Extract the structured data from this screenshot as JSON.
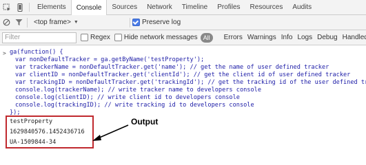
{
  "devtools": {
    "tabs": [
      {
        "label": "Elements",
        "active": false
      },
      {
        "label": "Console",
        "active": true
      },
      {
        "label": "Sources",
        "active": false
      },
      {
        "label": "Network",
        "active": false
      },
      {
        "label": "Timeline",
        "active": false
      },
      {
        "label": "Profiles",
        "active": false
      },
      {
        "label": "Resources",
        "active": false
      },
      {
        "label": "Audits",
        "active": false
      }
    ]
  },
  "toolbar": {
    "frame_select": "<top frame>",
    "preserve_log_label": "Preserve log",
    "preserve_log_checked": true
  },
  "filterbar": {
    "filter_placeholder": "Filter",
    "regex_label": "Regex",
    "hide_network_label": "Hide network messages",
    "all_label": "All",
    "levels": [
      "Errors",
      "Warnings",
      "Info",
      "Logs",
      "Debug",
      "Handled"
    ]
  },
  "console": {
    "input_lines": [
      "ga(function() {",
      "var nonDefaultTracker = ga.getByName('testProperty');",
      "var trackerName = nonDefaultTracker.get('name'); // get the name of user defined tracker",
      "var clientID = nonDefaultTracker.get('clientId'); // get the client id of user defined tracker",
      "var trackingID = nonDefaultTracker.get('trackingId'); // get the tracking id of the user defined tracker",
      "console.log(trackerName); // write tracker name to developers console",
      "console.log(clientID); // write client id to developers console",
      "console.log(trackingID); // write tracking id to developers console",
      "});"
    ],
    "output_lines": [
      "testProperty",
      "1629840576.1452436716",
      "UA-1509844-34"
    ]
  },
  "annotation": {
    "label": "Output",
    "color": "#c0282d"
  }
}
